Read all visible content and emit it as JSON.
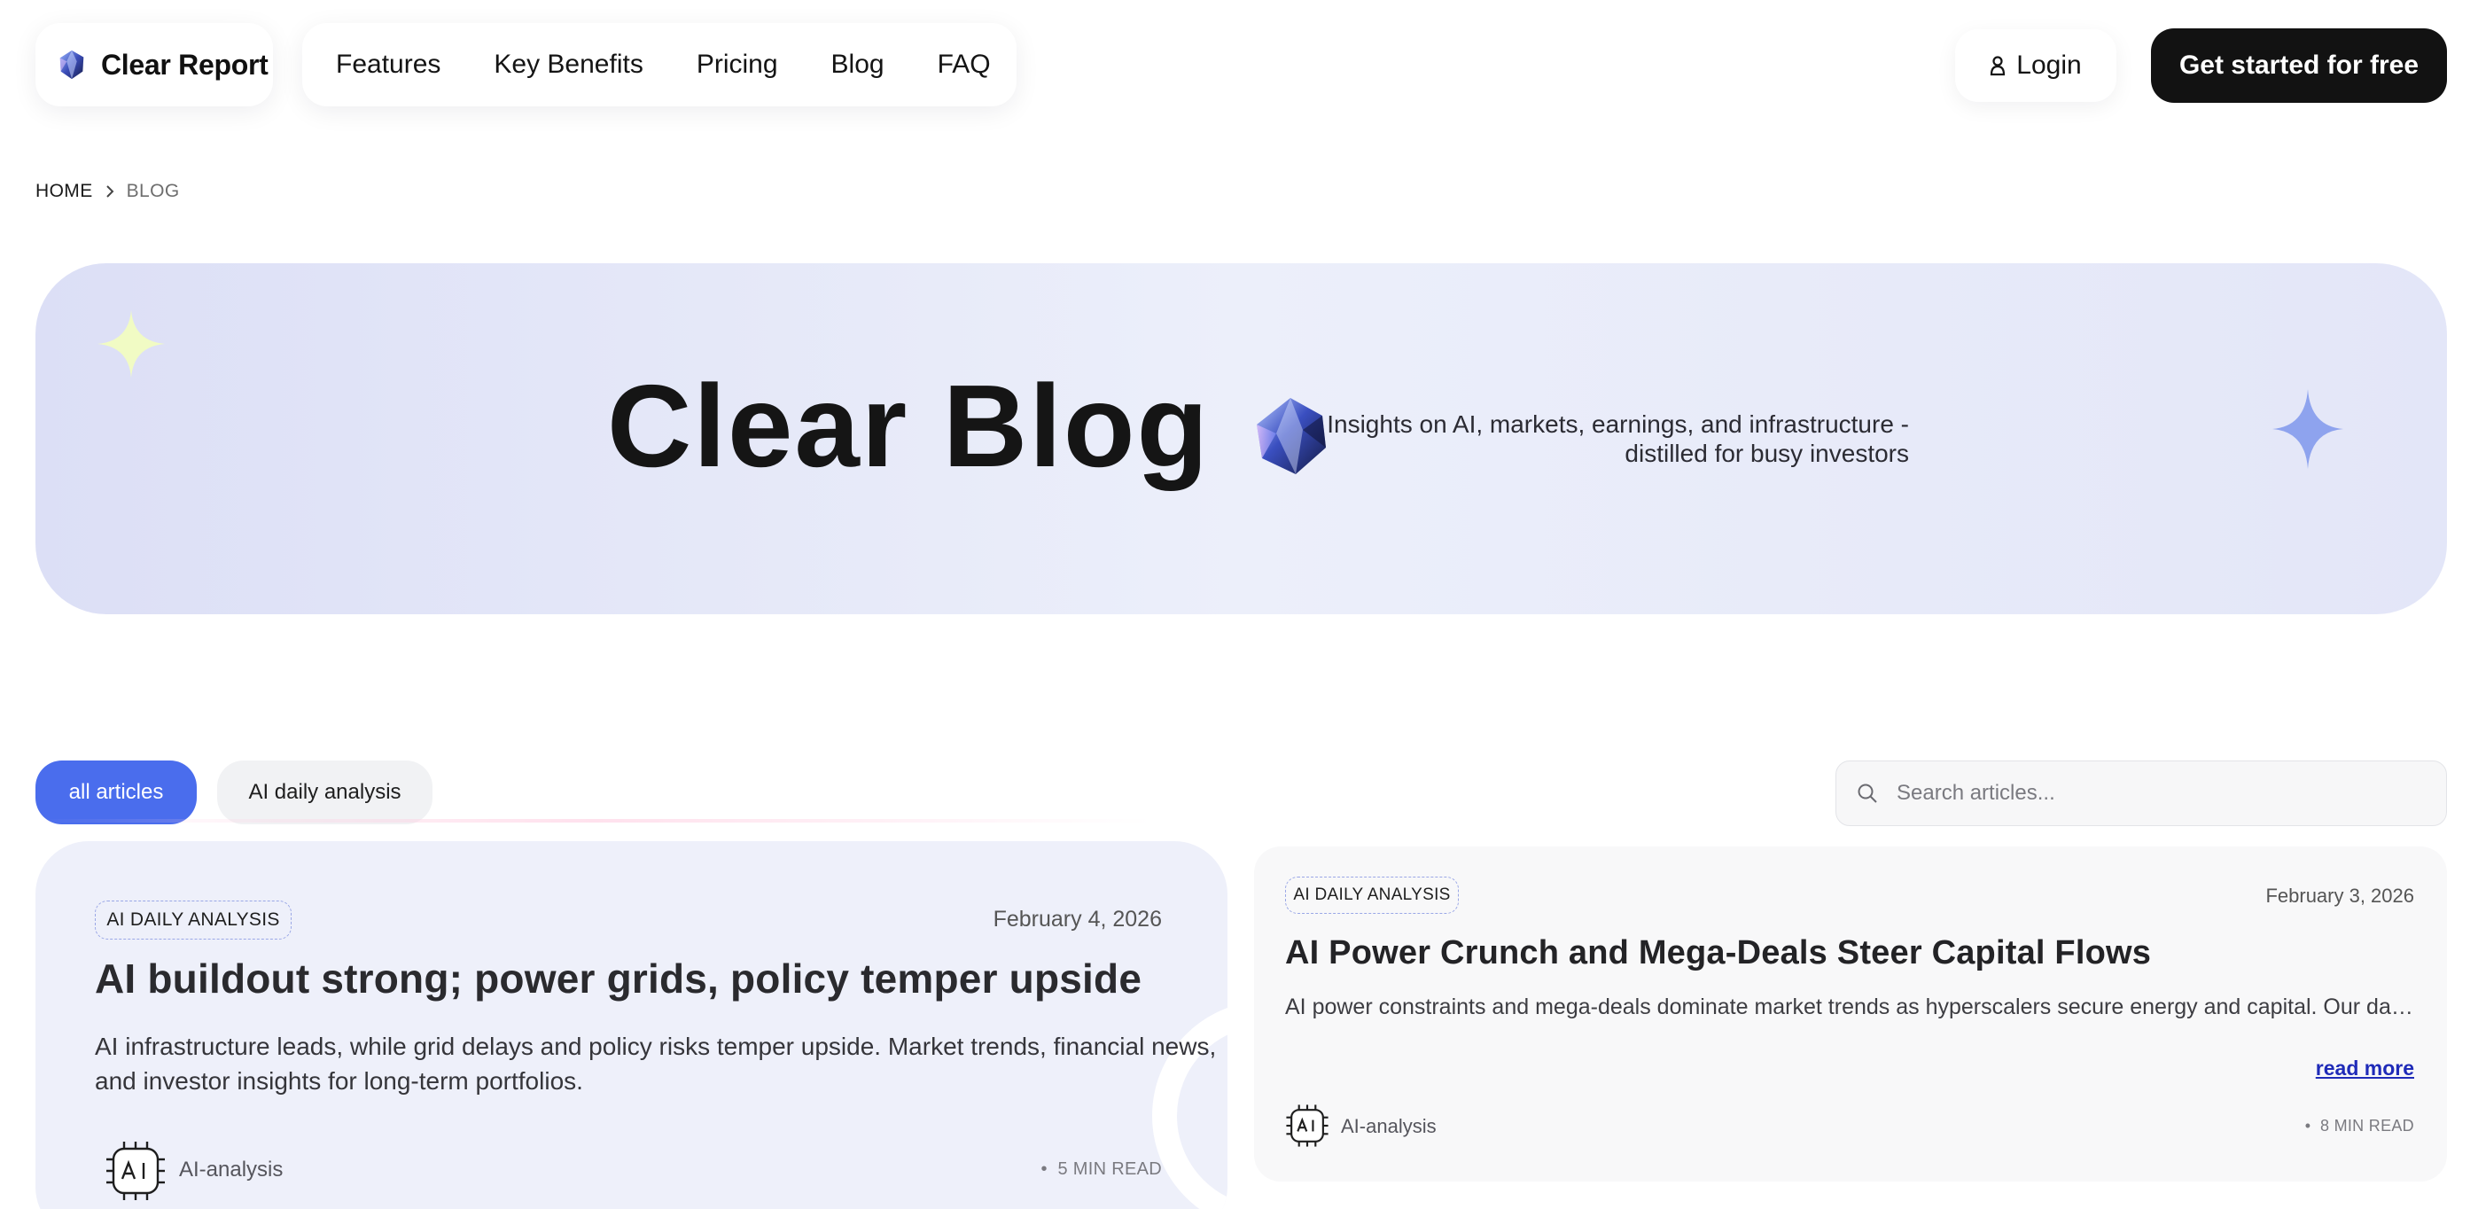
{
  "header": {
    "brand": "Clear Report",
    "nav": [
      "Features",
      "Key Benefits",
      "Pricing",
      "Blog",
      "FAQ"
    ],
    "login_label": "Login",
    "cta_label": "Get started for free"
  },
  "breadcrumb": {
    "home": "HOME",
    "current": "BLOG"
  },
  "hero": {
    "title": "Clear Blog",
    "subtitle": "Insights on AI, markets, earnings, and infrastructure - distilled for busy investors"
  },
  "filters": {
    "chips": [
      "all articles",
      "AI daily analysis"
    ],
    "active": "all articles",
    "search_placeholder": "Search articles..."
  },
  "articles": [
    {
      "tag": "AI DAILY ANALYSIS",
      "date": "February 4, 2026",
      "title": "AI buildout strong; power grids, policy temper upside",
      "excerpt": "AI infrastructure leads, while grid delays and policy risks temper upside. Market trends, financial news, and investor insights for long-term portfolios.",
      "author": "AI-analysis",
      "read_time": "5 MIN READ"
    },
    {
      "tag": "AI DAILY ANALYSIS",
      "date": "February 3, 2026",
      "title": "AI Power Crunch and Mega-Deals Steer Capital Flows",
      "excerpt": "AI power constraints and mega-deals dominate market trends as hyperscalers secure energy and capital. Our daily market analysis",
      "read_more": "read more",
      "author": "AI-analysis",
      "read_time": "8 MIN READ"
    }
  ],
  "colors": {
    "accent": "#4a6ded",
    "cta_bg": "#121212",
    "hero_bg": "#e3e6f8",
    "link": "#1f2bb8"
  },
  "icons": {
    "brand": "gem-logo-icon",
    "login": "user-icon",
    "breadcrumb_separator": "chevron-right-icon",
    "search": "search-icon",
    "author_avatar": "ai-chip-icon",
    "sparkles": "sparkle-icon"
  }
}
